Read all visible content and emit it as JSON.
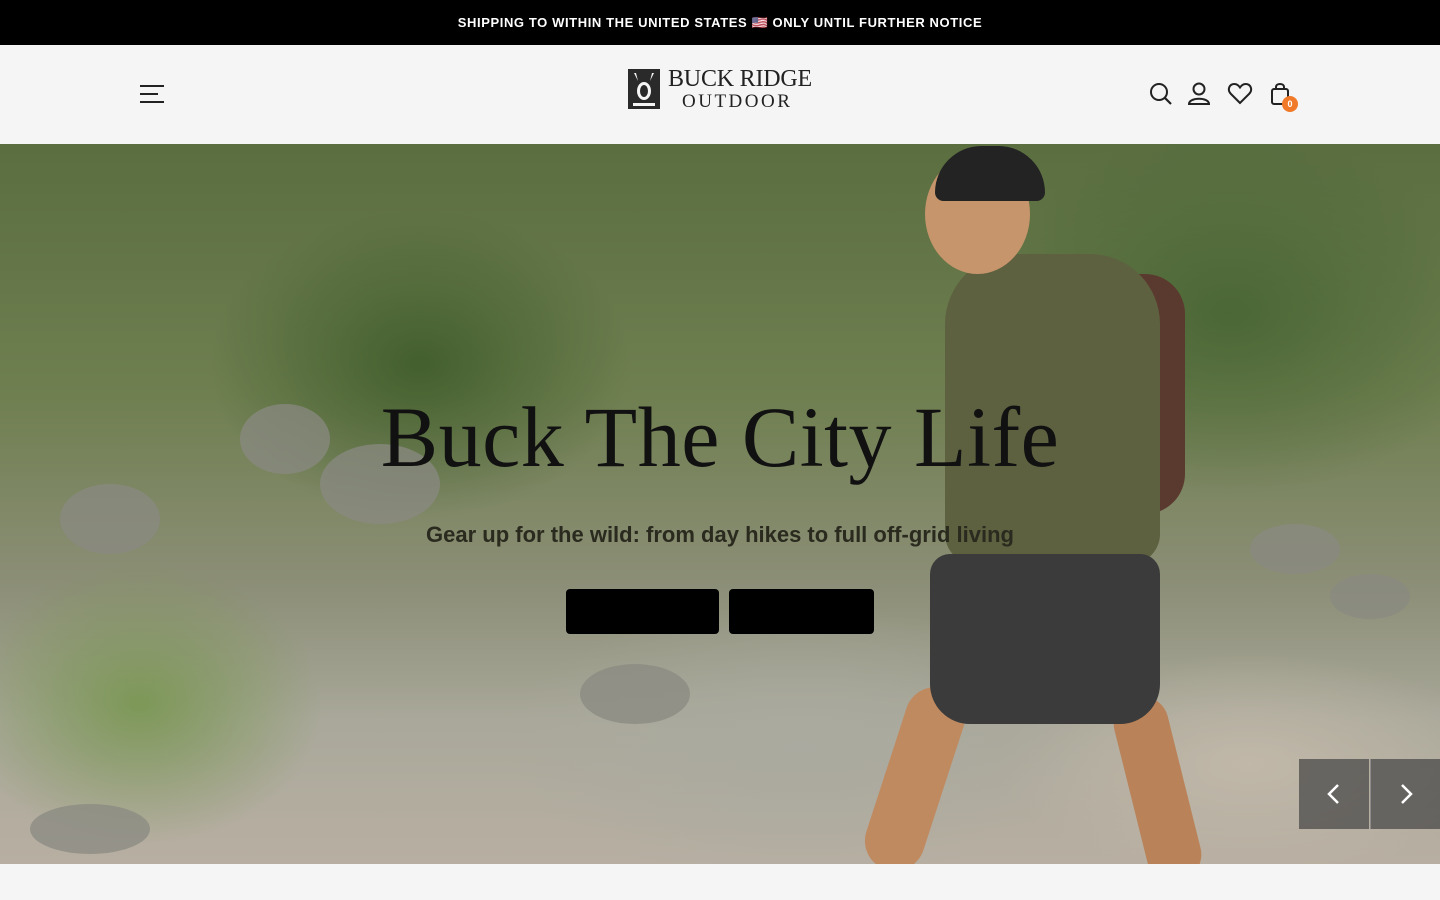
{
  "announcement": {
    "text": "SHIPPING TO WITHIN THE UNITED STATES 🇺🇸 ONLY UNTIL FURTHER NOTICE"
  },
  "header": {
    "logo": {
      "line1": "BUCK RIDGE",
      "line2": "OUTDOOR"
    },
    "menu_icon": "hamburger-menu-icon",
    "icons": [
      "search-icon",
      "account-icon",
      "wishlist-heart-icon",
      "cart-bag-icon"
    ],
    "cart_count": "0",
    "badge_color": "#f07a2a"
  },
  "hero": {
    "title": "Buck The City Life",
    "subtitle": "Gear up for the wild: from day hikes to full off-grid living",
    "buttons": [
      {
        "label": ""
      },
      {
        "label": ""
      }
    ],
    "arrows": [
      "chevron-left-icon",
      "chevron-right-icon"
    ]
  }
}
